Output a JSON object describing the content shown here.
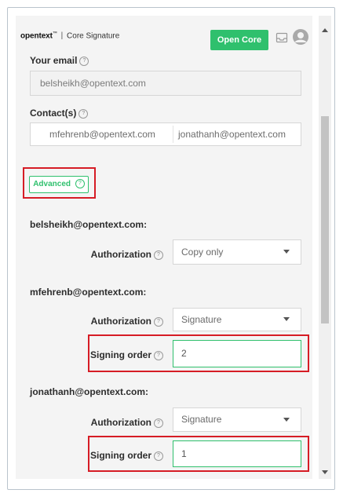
{
  "header": {
    "brand": "opentext",
    "tm": "™",
    "separator": "|",
    "product": "Core Signature",
    "open_core_label": "Open Core",
    "icons": [
      "inbox-icon",
      "user-avatar-icon"
    ]
  },
  "form": {
    "your_email_label": "Your email",
    "your_email_value": "belsheikh@opentext.com",
    "contacts_label": "Contact(s)",
    "contacts": [
      "mfehrenb@opentext.com",
      "jonathanh@opentext.com"
    ],
    "advanced_label": "Advanced",
    "help_glyph": "?"
  },
  "signers": [
    {
      "email": "belsheikh@opentext.com:",
      "authorization_label": "Authorization",
      "authorization_value": "Copy only"
    },
    {
      "email": "mfehrenb@opentext.com:",
      "authorization_label": "Authorization",
      "authorization_value": "Signature",
      "signing_order_label": "Signing order",
      "signing_order_value": "2"
    },
    {
      "email": "jonathanh@opentext.com:",
      "authorization_label": "Authorization",
      "authorization_value": "Signature",
      "signing_order_label": "Signing order",
      "signing_order_value": "1"
    }
  ],
  "colors": {
    "accent_green": "#2fc06d",
    "highlight_red": "#d61c25"
  }
}
